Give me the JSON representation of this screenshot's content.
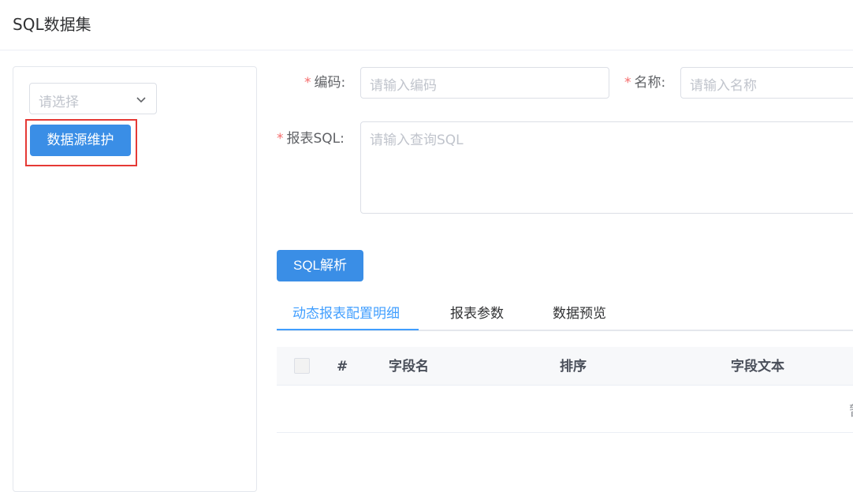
{
  "header": {
    "title": "SQL数据集"
  },
  "left_panel": {
    "select_placeholder": "请选择",
    "datasource_button": "数据源维护"
  },
  "form": {
    "code_label": "编码:",
    "code_placeholder": "请输入编码",
    "name_label": "名称:",
    "name_placeholder": "请输入名称",
    "sql_label": "报表SQL:",
    "sql_placeholder": "请输入查询SQL",
    "required_mark": "*"
  },
  "sql_parse_button": "SQL解析",
  "tabs": [
    {
      "label": "动态报表配置明细",
      "active": true
    },
    {
      "label": "报表参数",
      "active": false
    },
    {
      "label": "数据预览",
      "active": false
    }
  ],
  "table": {
    "columns": [
      "#",
      "字段名",
      "排序",
      "字段文本"
    ],
    "empty_text_visible_fragment": "暂"
  },
  "colors": {
    "primary": "#3a8ee6",
    "tab_active": "#409eff",
    "required": "#f56c6c",
    "highlight_border": "#e53935"
  },
  "icons": {
    "select_chevron": "chevron-down-icon"
  }
}
